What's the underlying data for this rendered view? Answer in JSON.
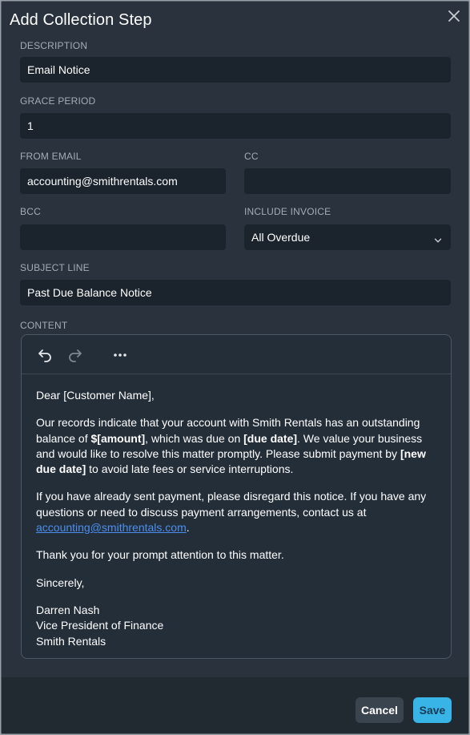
{
  "dialog": {
    "title": "Add Collection Step"
  },
  "fields": {
    "description": {
      "label": "DESCRIPTION",
      "value": "Email Notice"
    },
    "grace_period": {
      "label": "GRACE PERIOD",
      "value": "1"
    },
    "from_email": {
      "label": "FROM EMAIL",
      "value": "accounting@smithrentals.com"
    },
    "cc": {
      "label": "CC",
      "value": ""
    },
    "bcc": {
      "label": "BCC",
      "value": ""
    },
    "include_invoice": {
      "label": "INCLUDE INVOICE",
      "value": "All Overdue"
    },
    "subject_line": {
      "label": "SUBJECT LINE",
      "value": "Past Due Balance Notice"
    },
    "content_label": "CONTENT"
  },
  "editor": {
    "toolbar": {
      "undo_icon": "undo-icon",
      "redo_icon": "redo-icon",
      "more_icon": "more-horizontal-icon"
    },
    "greeting": "Dear [Customer Name],",
    "p1_a": "Our records indicate that your account with Smith Rentals has an outstanding balance of ",
    "p1_amount": "$[amount]",
    "p1_b": ", which was due on ",
    "p1_due": "[due date]",
    "p1_c": ". We value your business and would like to resolve this matter promptly. Please submit payment by ",
    "p1_new_due": "[new due date]",
    "p1_d": " to avoid late fees or service interruptions.",
    "p2_a": "If you have already sent payment, please disregard this notice. If you have any questions or need to discuss payment arrangements, contact us at ",
    "p2_link": "accounting@smithrentals.com",
    "p2_b": ".",
    "p3": "Thank you for your prompt attention to this matter.",
    "closing": "Sincerely,",
    "sig_name": "Darren Nash",
    "sig_title": "Vice President of Finance",
    "sig_company": "Smith Rentals"
  },
  "footer": {
    "cancel_label": "Cancel",
    "save_label": "Save"
  },
  "colors": {
    "dialog_bg": "#2a333d",
    "field_bg": "#1b232c",
    "link": "#4b8ff0",
    "save_button": "#38b4e6"
  }
}
